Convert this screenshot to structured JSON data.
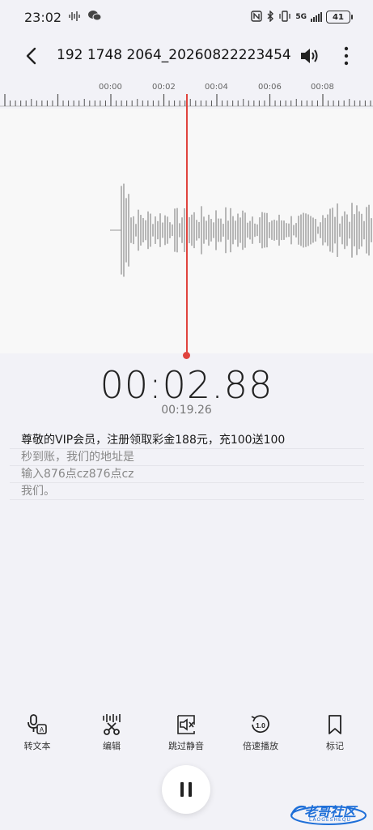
{
  "status_bar": {
    "time": "23:02",
    "network": "5G",
    "battery": "41"
  },
  "header": {
    "title": "192 1748 2064_20260822223454"
  },
  "ruler": {
    "labels": [
      "00:00",
      "00:02",
      "00:04",
      "00:06",
      "00:08"
    ]
  },
  "playback": {
    "current_time": "00:02.88",
    "total_time": "00:19.26"
  },
  "transcript": {
    "lines": [
      "尊敬的VIP会员，注册领取彩金188元，充100送100",
      "秒到账，我们的地址是",
      "输入876点cz876点cz",
      "我们。"
    ]
  },
  "toolbar": {
    "items": [
      {
        "label": "转文本",
        "icon": "speech-to-text-icon"
      },
      {
        "label": "编辑",
        "icon": "scissors-edit-icon"
      },
      {
        "label": "跳过静音",
        "icon": "skip-silence-icon"
      },
      {
        "label": "倍速播放",
        "icon": "playback-speed-icon"
      },
      {
        "label": "标记",
        "icon": "bookmark-icon"
      }
    ],
    "speed_value": "1.0"
  },
  "watermark": {
    "text": "老哥社区",
    "sub": "LAOGESHEQU"
  },
  "colors": {
    "playhead": "#e0443e",
    "background": "#f2f2f7",
    "watermark": "#1e6fd8"
  }
}
